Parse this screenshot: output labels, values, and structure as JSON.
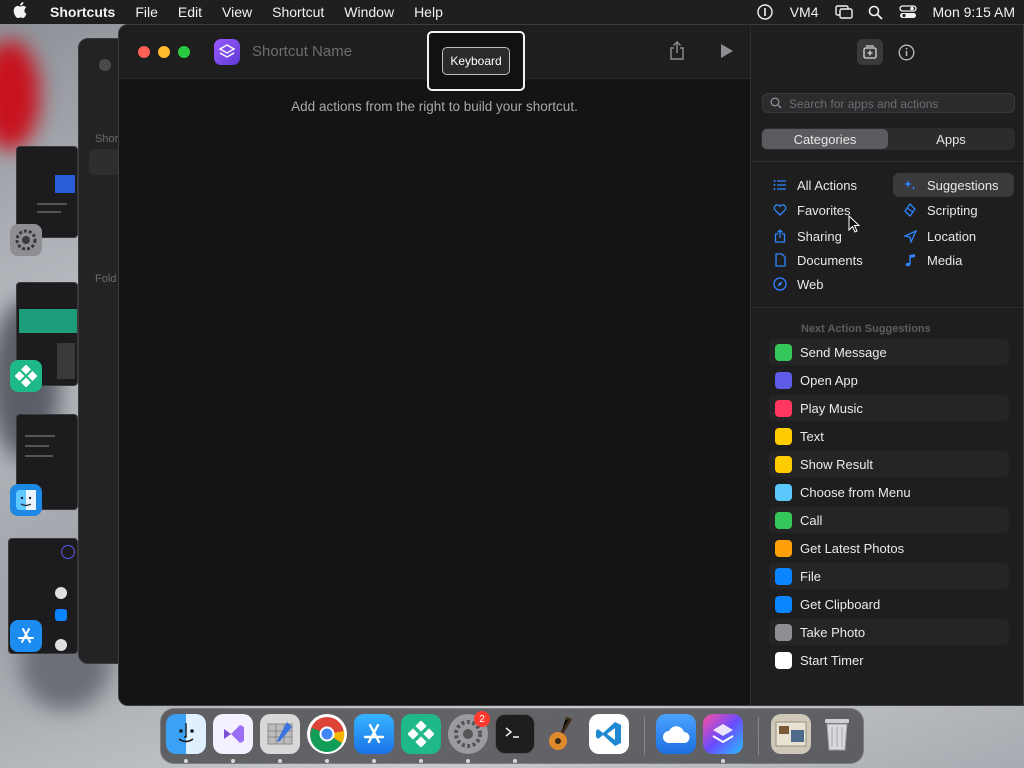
{
  "menubar": {
    "app_name": "Shortcuts",
    "items": [
      "File",
      "Edit",
      "View",
      "Shortcut",
      "Window",
      "Help"
    ],
    "status_text": "VM4",
    "clock": "Mon 9:15 AM"
  },
  "back_window": {
    "label_1": "Shor",
    "label_2": "Fold"
  },
  "editor": {
    "shortcut_name_placeholder": "Shortcut Name",
    "empty_hint": "Add actions from the right to build your shortcut.",
    "tooltip": "Keyboard"
  },
  "sidebar": {
    "search_placeholder": "Search for apps and actions",
    "segments": [
      "Categories",
      "Apps"
    ],
    "categories_left": [
      "All Actions",
      "Favorites",
      "Sharing",
      "Documents",
      "Web"
    ],
    "categories_right": [
      "Suggestions",
      "Scripting",
      "Location",
      "Media"
    ],
    "suggestions_title": "Next Action Suggestions",
    "suggestions": [
      {
        "label": "Send Message",
        "color": "#34c759"
      },
      {
        "label": "Open App",
        "color": "#5e5ce6"
      },
      {
        "label": "Play Music",
        "color": "#ff375f"
      },
      {
        "label": "Text",
        "color": "#ffcc00"
      },
      {
        "label": "Show Result",
        "color": "#ffcc00"
      },
      {
        "label": "Choose from Menu",
        "color": "#5ac8fa"
      },
      {
        "label": "Call",
        "color": "#34c759"
      },
      {
        "label": "Get Latest Photos",
        "color": "#ff9f0a"
      },
      {
        "label": "File",
        "color": "#0a84ff"
      },
      {
        "label": "Get Clipboard",
        "color": "#0a84ff"
      },
      {
        "label": "Take Photo",
        "color": "#8e8e93"
      },
      {
        "label": "Start Timer",
        "color": "#ffffff"
      }
    ]
  },
  "dock": {
    "settings_badge": "2"
  }
}
